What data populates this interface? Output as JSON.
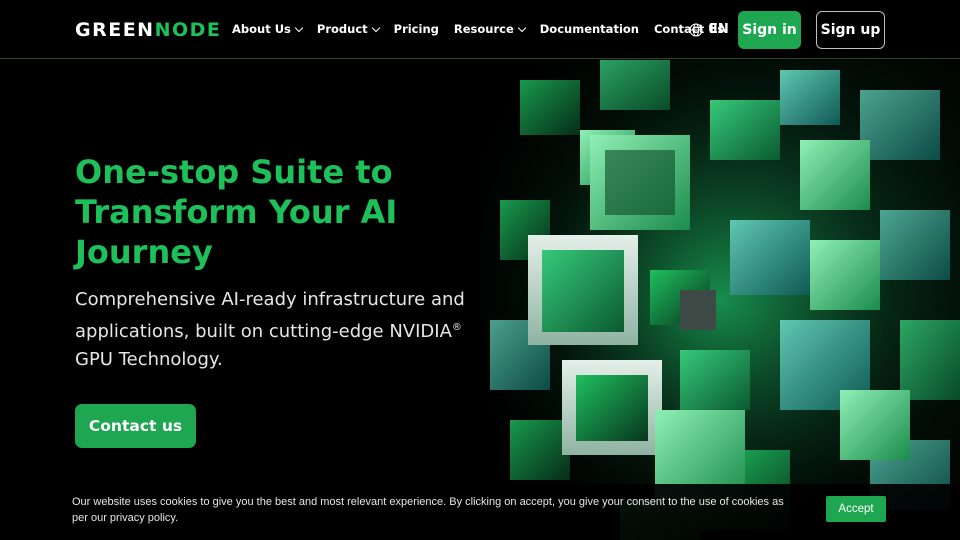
{
  "header": {
    "logo": {
      "part1": "GREEN",
      "part2": "NODE"
    },
    "nav": [
      {
        "label": "About Us",
        "dropdown": true
      },
      {
        "label": "Product",
        "dropdown": true
      },
      {
        "label": "Pricing",
        "dropdown": false
      },
      {
        "label": "Resource",
        "dropdown": true
      },
      {
        "label": "Documentation",
        "dropdown": false
      },
      {
        "label": "Contact Us",
        "dropdown": false
      }
    ],
    "language": "EN",
    "signin_label": "Sign in",
    "signup_label": "Sign up"
  },
  "hero": {
    "headline": "One-stop Suite to Transform Your AI Journey",
    "subtext": "Comprehensive AI-ready infrastructure and applications, built on cutting-edge NVIDIA",
    "subtext_mark": "®",
    "subtext_end": "GPU Technology.",
    "cta_label": "Contact us"
  },
  "cookie": {
    "text": "Our website uses cookies to give you the best and most relevant experience. By clicking on accept, you give your consent to the use of cookies as per our privacy policy.",
    "accept_label": "Accept"
  },
  "colors": {
    "brand_green": "#1ea651",
    "headline_green": "#1ec05a",
    "background": "#000000"
  },
  "icons": [
    "globe-icon",
    "chevron-down-icon"
  ]
}
